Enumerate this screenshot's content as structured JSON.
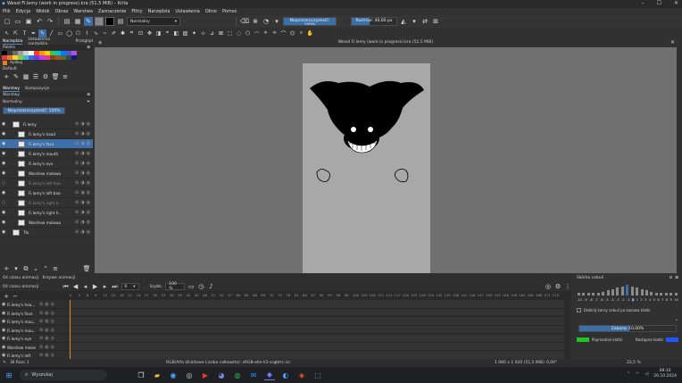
{
  "window": {
    "title": "Wesoł Fi.lemy (work in progress).kra (51,5 MiB)  –  Krita",
    "min": "–",
    "max": "☐",
    "close": "✕"
  },
  "menu": [
    "Plik",
    "Edycja",
    "Widok",
    "Obraz",
    "Warstwa",
    "Zaznaczenie",
    "Filtry",
    "Narzędzia",
    "Ustawienia",
    "Okno",
    "Pomoc"
  ],
  "toolbar": {
    "blend_mode": "Normalny",
    "opacity": {
      "label": "Nieprzezroczystość: 100%",
      "value": 1.0
    },
    "size": {
      "label": "Rozmiar: 40,00 px",
      "value": 0.4
    }
  },
  "left_dock": {
    "top_tabs": [
      "Narzędzia",
      "Ustawienia narzędzia",
      "Przegląd"
    ],
    "palette_title": "Paleta",
    "palette_label": "Aplikuj",
    "palette_default": "Default",
    "colors": [
      "#000000",
      "#3a3a3a",
      "#6c6c6c",
      "#a0a0a0",
      "#d0d0d0",
      "#ffffff",
      "#ff3b30",
      "#ff9500",
      "#ffcc00",
      "#34c759",
      "#00c7be",
      "#007aff",
      "#5856d6",
      "#af52de",
      "#e33a3a",
      "#e77b2a",
      "#f3d33a",
      "#7fcf3a",
      "#3ab8cf",
      "#3a6fe3",
      "#6a3ae3",
      "#c63ae3",
      "#e33a9a",
      "#8b4513",
      "#a0522d",
      "#556b2f",
      "#2f4f4f",
      "#191970"
    ],
    "mid_tabs": [
      "Warstwy",
      "Kompozycje"
    ],
    "layers_title": "Warstwy",
    "layer_blend": "Normalny",
    "layer_opacity": "Nieprzezroczystość: 100%",
    "layers": [
      {
        "name": "Fi.lemy",
        "sel": false,
        "dim": false,
        "indent": 0
      },
      {
        "name": "Fi.lemy's head",
        "sel": false,
        "dim": false,
        "indent": 1
      },
      {
        "name": "Fi.lemy's face",
        "sel": true,
        "dim": false,
        "indent": 1
      },
      {
        "name": "Fi.lemy's mouth",
        "sel": false,
        "dim": false,
        "indent": 1
      },
      {
        "name": "Fi.lemy's eye",
        "sel": false,
        "dim": false,
        "indent": 1
      },
      {
        "name": "Wardrow malowanie",
        "sel": false,
        "dim": false,
        "indent": 1
      },
      {
        "name": "Fi.lemy's left hand",
        "sel": false,
        "dim": true,
        "indent": 1
      },
      {
        "name": "Fi.lemy's left band",
        "sel": false,
        "dim": false,
        "indent": 1
      },
      {
        "name": "Fi.lemy's right h...",
        "sel": false,
        "dim": true,
        "indent": 1
      },
      {
        "name": "Fi.lemy's right h...",
        "sel": false,
        "dim": false,
        "indent": 1
      },
      {
        "name": "Wardrow malowanie",
        "sel": false,
        "dim": false,
        "indent": 1
      },
      {
        "name": "Tło",
        "sel": false,
        "dim": false,
        "indent": 0
      }
    ]
  },
  "canvas": {
    "tab_title": "Wesoł Fi.lemy (work in progress).kra (51,5 MiB)"
  },
  "timeline": {
    "tabs": [
      "Oś czasu animacji",
      "Krzywe animacji"
    ],
    "title": "Oś czasu animacji",
    "frame": "0",
    "speed": "Szybk.",
    "zoom": "100 %",
    "ticks": [
      "0",
      "3",
      "6",
      "9",
      "12",
      "15",
      "18",
      "21",
      "24",
      "27",
      "30",
      "33",
      "36",
      "39",
      "42",
      "45",
      "48",
      "51",
      "54",
      "57",
      "60",
      "63",
      "66",
      "69",
      "72",
      "75",
      "78",
      "81",
      "84",
      "87",
      "90",
      "93",
      "96",
      "99",
      "102",
      "105",
      "108",
      "111",
      "114",
      "117",
      "120",
      "123",
      "126",
      "129",
      "132",
      "135",
      "138",
      "141",
      "144",
      "147",
      "150",
      "153",
      "156",
      "159",
      "162",
      "165",
      "168",
      "171",
      "174"
    ],
    "rows": [
      "Fi.lemy's hea...",
      "Fi.lemy's face",
      "Fi.lemy's mou...",
      "Fi.lemy's mou...",
      "Fi.lemy's eye",
      "Wardrow malow...",
      "Fi.lemy's left"
    ]
  },
  "right_dock": {
    "title": "Skórka cebuli",
    "ticks": [
      "-10",
      "-9",
      "-8",
      "-7",
      "-6",
      "-5",
      "-4",
      "-3",
      "-2",
      "-1",
      "0",
      "1",
      "2",
      "3",
      "4",
      "5",
      "6",
      "7",
      "8",
      "9",
      "10"
    ],
    "active_tick": "0",
    "checkbox_label": "Dotknij kanry cebuli po kasowa klatki",
    "tint_label": "Zabarw. 10,00%",
    "prev_label": "Poprzednie klatki",
    "next_label": "Następne klatki"
  },
  "statusbar": {
    "layer": "Bł Rozc 1",
    "brush": "RGB/Alfa (8-bitowe Liczba całkowita): sRGB-elle-V2-srgbtrc.icc",
    "dims": "1 080 x 1 920 (51,5 MiB)",
    "angle": "0,00°",
    "zoom": "22,5 %"
  },
  "taskbar": {
    "search": "Wyszukaj",
    "time": "08:16",
    "date": "26.10.2024"
  }
}
